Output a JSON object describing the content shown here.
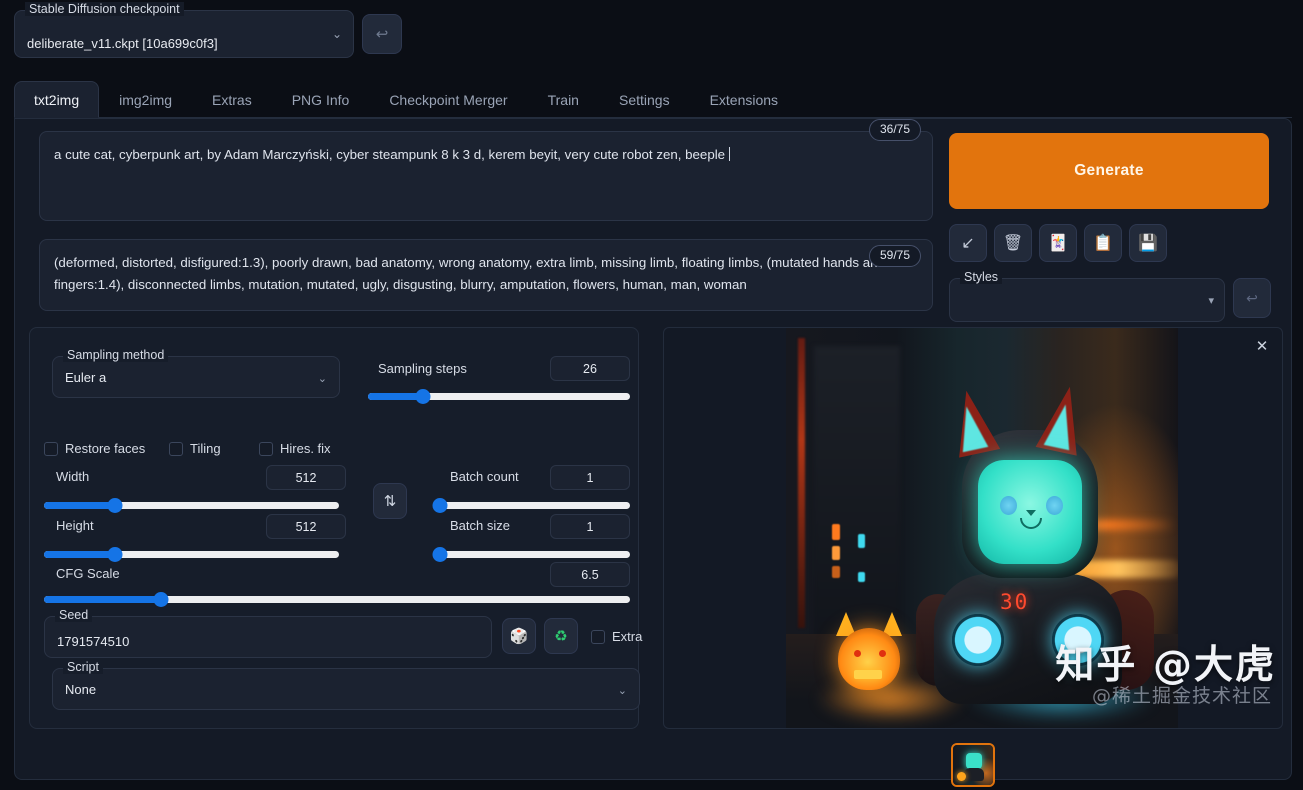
{
  "checkpoint": {
    "label": "Stable Diffusion checkpoint",
    "value": "deliberate_v11.ckpt [10a699c0f3]",
    "chevron": "⌄",
    "refresh_icon": "↩"
  },
  "tabs": [
    {
      "label": "txt2img",
      "active": true
    },
    {
      "label": "img2img",
      "active": false
    },
    {
      "label": "Extras",
      "active": false
    },
    {
      "label": "PNG Info",
      "active": false
    },
    {
      "label": "Checkpoint Merger",
      "active": false
    },
    {
      "label": "Train",
      "active": false
    },
    {
      "label": "Settings",
      "active": false
    },
    {
      "label": "Extensions",
      "active": false
    }
  ],
  "prompt": {
    "positive": "a cute cat, cyberpunk art, by Adam Marczyński, cyber steampunk 8 k 3 d, kerem beyit, very cute robot zen, beeple ",
    "positive_tokens": "36/75",
    "negative": "(deformed, distorted, disfigured:1.3), poorly drawn, bad anatomy, wrong anatomy, extra limb, missing limb, floating limbs, (mutated hands and fingers:1.4), disconnected limbs, mutation, mutated, ugly, disgusting, blurry, amputation, flowers, human, man, woman",
    "negative_tokens": "59/75"
  },
  "generate": {
    "label": "Generate",
    "color": "#e2740d"
  },
  "tool_icons": [
    {
      "name": "arrow-down-left-icon",
      "glyph": "↙"
    },
    {
      "name": "trash-icon",
      "glyph": "🗑"
    },
    {
      "name": "card-icon",
      "glyph": "🃏"
    },
    {
      "name": "clipboard-icon",
      "glyph": "📋"
    },
    {
      "name": "floppy-save-icon",
      "glyph": "💾"
    }
  ],
  "styles": {
    "label": "Styles",
    "value": "",
    "chevron": "▾",
    "refresh_icon": "↩"
  },
  "settings": {
    "sampling_method": {
      "label": "Sampling method",
      "value": "Euler a",
      "chevron": "⌄"
    },
    "sampling_steps": {
      "label": "Sampling steps",
      "value": "26",
      "fill_pct": 21
    },
    "checkboxes": [
      {
        "label": "Restore faces",
        "checked": false
      },
      {
        "label": "Tiling",
        "checked": false
      },
      {
        "label": "Hires. fix",
        "checked": false
      }
    ],
    "width": {
      "label": "Width",
      "value": "512",
      "fill_pct": 24
    },
    "height": {
      "label": "Height",
      "value": "512",
      "fill_pct": 24
    },
    "batch_count": {
      "label": "Batch count",
      "value": "1",
      "fill_pct": 0
    },
    "batch_size": {
      "label": "Batch size",
      "value": "1",
      "fill_pct": 0
    },
    "cfg_scale": {
      "label": "CFG Scale",
      "value": "6.5",
      "fill_pct": 20
    },
    "swap_icon": "⇅",
    "seed": {
      "label": "Seed",
      "value": "1791574510"
    },
    "seed_dice_icon": "🎲",
    "seed_recycle_icon": "♻",
    "extra": {
      "label": "Extra",
      "checked": false
    },
    "script": {
      "label": "Script",
      "value": "None",
      "chevron": "⌄"
    }
  },
  "gallery": {
    "close_icon": "✕",
    "robot_display": "30",
    "watermark_main": "知乎 @大虎",
    "watermark_sub": "@稀土掘金技术社区",
    "thumbnail_selected": true
  }
}
